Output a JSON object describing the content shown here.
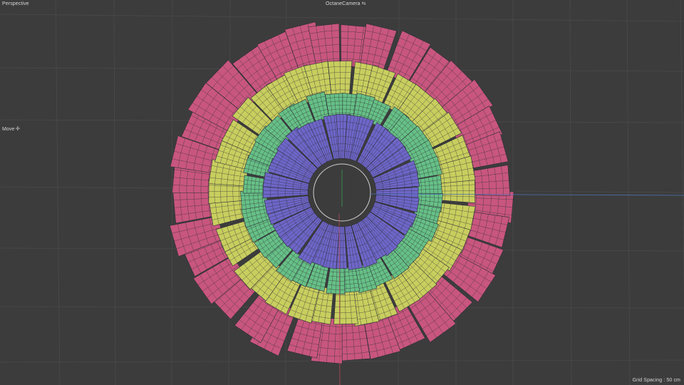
{
  "viewport": {
    "view_name": "Perspective",
    "camera_name": "OctaneCamera",
    "camera_icon": "camera-link-icon",
    "tool_name": "Move",
    "tool_icon": "move-cross-icon",
    "grid_spacing": "Grid Spacing : 50 cm"
  },
  "scene": {
    "background": "#3c3c3c",
    "grid_color": "#4a4a4a",
    "wire_color": "#2e2e38",
    "ring_colors": [
      "#6e66c8",
      "#66c086",
      "#c8ce5e",
      "#c8567e"
    ],
    "axis_x_color": "#4a72b0",
    "axis_y_color": "#3a9a4a",
    "axis_z_color": "#b24a5a"
  }
}
